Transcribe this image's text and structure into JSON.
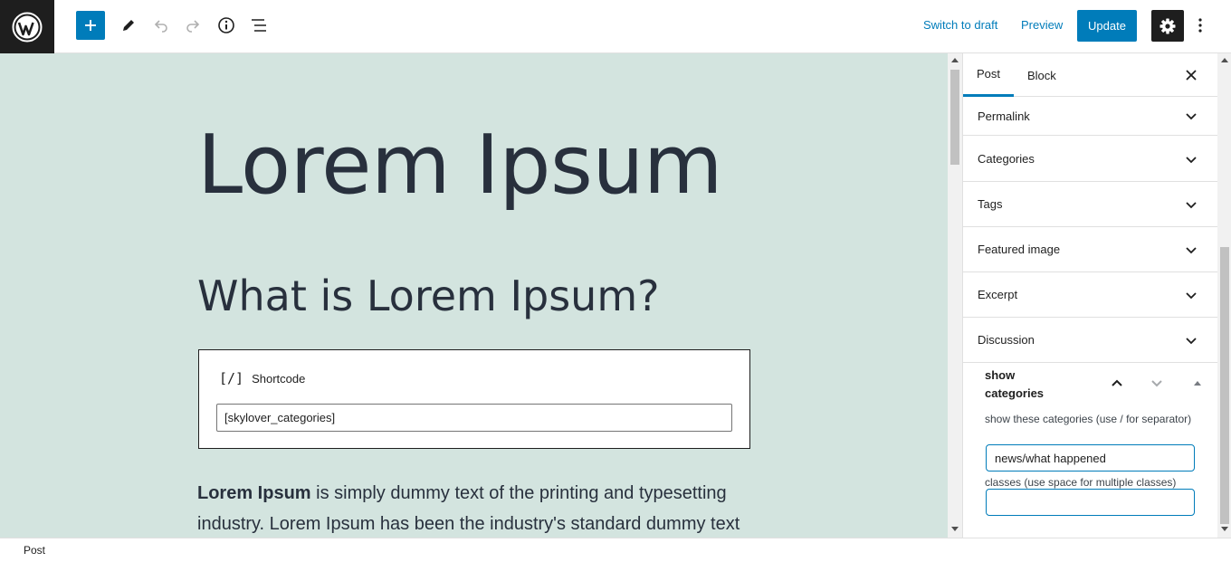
{
  "toolbar": {
    "switch_to_draft": "Switch to draft",
    "preview": "Preview",
    "update": "Update"
  },
  "editor": {
    "title": "Lorem Ipsum",
    "heading": "What is Lorem Ipsum?",
    "shortcode": {
      "icon": "[/]",
      "label": "Shortcode",
      "value": "[skylover_categories]"
    },
    "paragraph_bold": "Lorem Ipsum",
    "paragraph_rest": " is simply dummy text of the printing and typesetting industry. Lorem Ipsum has been the industry's standard dummy text"
  },
  "sidebar": {
    "tabs": [
      "Post",
      "Block"
    ],
    "panels": [
      "Permalink",
      "Categories",
      "Tags",
      "Featured image",
      "Excerpt",
      "Discussion"
    ],
    "custom_box": {
      "title": "show categories",
      "field1_label": "show these categories (use / for separator)",
      "field1_value": "news/what happened",
      "field2_label": "classes (use space for multiple classes)",
      "field2_value": ""
    }
  },
  "footer": {
    "breadcrumb": "Post"
  },
  "colors": {
    "accent": "#007cba",
    "canvas_bg": "#d3e4df",
    "dark": "#1e1e1e"
  }
}
